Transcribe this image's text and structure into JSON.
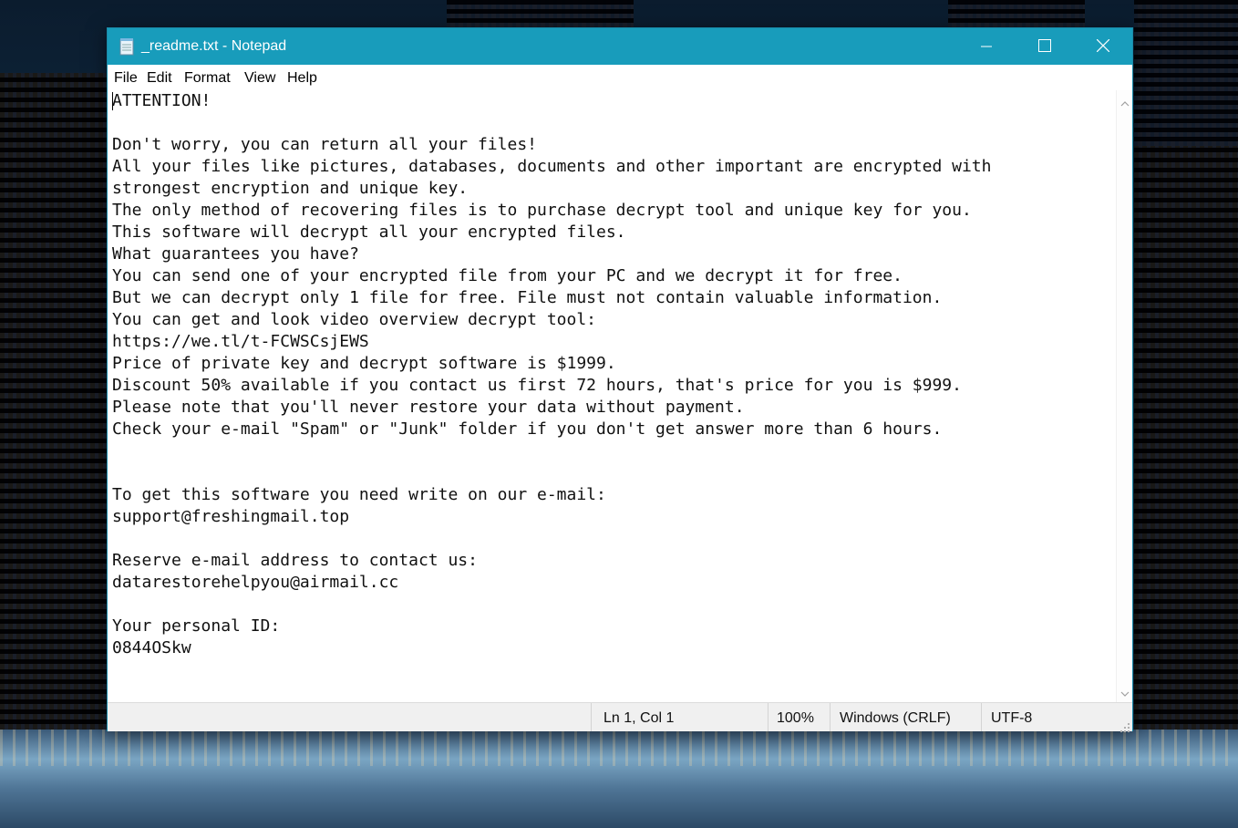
{
  "window": {
    "title": "_readme.txt - Notepad",
    "app_icon": "notepad-icon",
    "controls": {
      "minimize_icon": "minimize-icon",
      "maximize_icon": "maximize-icon",
      "close_icon": "close-icon"
    },
    "accent_color": "#189cbb"
  },
  "menu": {
    "items": [
      "File",
      "Edit",
      "Format",
      "View",
      "Help"
    ]
  },
  "editor": {
    "lines": [
      "ATTENTION!",
      "",
      "Don't worry, you can return all your files!",
      "All your files like pictures, databases, documents and other important are encrypted with",
      "strongest encryption and unique key.",
      "The only method of recovering files is to purchase decrypt tool and unique key for you.",
      "This software will decrypt all your encrypted files.",
      "What guarantees you have?",
      "You can send one of your encrypted file from your PC and we decrypt it for free.",
      "But we can decrypt only 1 file for free. File must not contain valuable information.",
      "You can get and look video overview decrypt tool:",
      "https://we.tl/t-FCWSCsjEWS",
      "Price of private key and decrypt software is $1999.",
      "Discount 50% available if you contact us first 72 hours, that's price for you is $999.",
      "Please note that you'll never restore your data without payment.",
      "Check your e-mail \"Spam\" or \"Junk\" folder if you don't get answer more than 6 hours.",
      "",
      "",
      "To get this software you need write on our e-mail:",
      "support@freshingmail.top",
      "",
      "Reserve e-mail address to contact us:",
      "datarestorehelpyou@airmail.cc",
      "",
      "Your personal ID:",
      "0844OSkw"
    ]
  },
  "statusbar": {
    "position": "Ln 1, Col 1",
    "zoom": "100%",
    "line_ending": "Windows (CRLF)",
    "encoding": "UTF-8"
  }
}
